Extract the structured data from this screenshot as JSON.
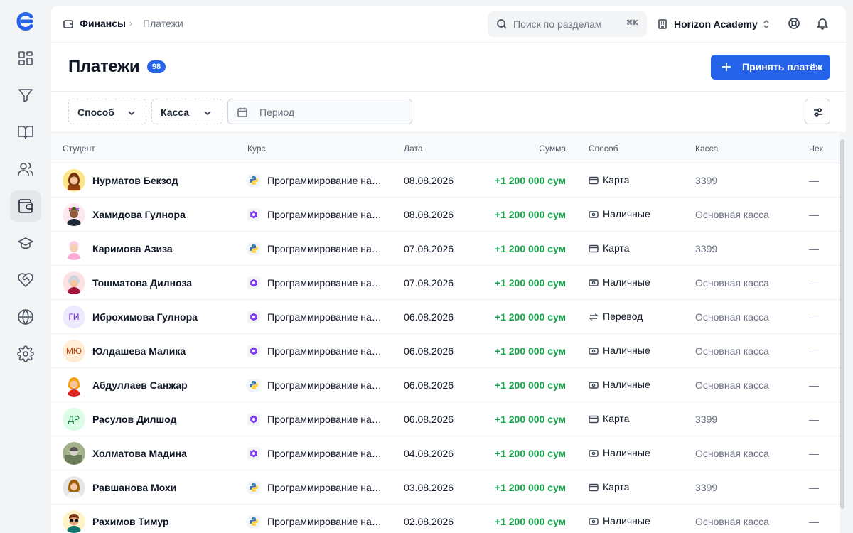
{
  "sidebar": {
    "logo": "E",
    "items": [
      {
        "icon": "dashboard-icon",
        "active": false
      },
      {
        "icon": "funnel-icon",
        "active": false
      },
      {
        "icon": "book-icon",
        "active": false
      },
      {
        "icon": "users-icon",
        "active": false
      },
      {
        "icon": "wallet-icon",
        "active": true
      },
      {
        "icon": "graduation-cap-icon",
        "active": false
      },
      {
        "icon": "heart-handshake-icon",
        "active": false
      },
      {
        "icon": "globe-icon",
        "active": false
      },
      {
        "icon": "gear-icon",
        "active": false
      }
    ]
  },
  "topbar": {
    "breadcrumb_root": "Финансы",
    "breadcrumb_sep": "›",
    "breadcrumb_current": "Платежи",
    "search_placeholder": "Поиск по разделам",
    "search_shortcut": "⌘K",
    "org_name": "Horizon Academy"
  },
  "header": {
    "title": "Платежи",
    "count": "98",
    "primary_button": "Принять платёж"
  },
  "filters": {
    "method_label": "Способ",
    "cashbox_label": "Касса",
    "period_placeholder": "Период"
  },
  "table": {
    "columns": {
      "student": "Студент",
      "course": "Курс",
      "date": "Дата",
      "amount": "Сумма",
      "method": "Способ",
      "cashbox": "Касса",
      "receipt": "Чек"
    },
    "rows": [
      {
        "avatar": "photo",
        "avatar_style": "woman-hijab",
        "name": "Нурматов Бекзод",
        "course_icon": "python",
        "course": "Программирование на Python",
        "date": "08.08.2026",
        "amount": "+1 200 000 сум",
        "method_icon": "card",
        "method": "Карта",
        "cashbox": "3399",
        "receipt": "—"
      },
      {
        "avatar": "photo",
        "avatar_style": "man-curly",
        "name": "Хамидова Гулнора",
        "course_icon": "hex",
        "course": "Программирование на C#",
        "date": "08.08.2026",
        "amount": "+1 200 000 сум",
        "method_icon": "cash",
        "method": "Наличные",
        "cashbox": "Основная касса",
        "receipt": "—"
      },
      {
        "avatar": "photo",
        "avatar_style": "woman-pink",
        "name": "Каримова Азиза",
        "course_icon": "python",
        "course": "Программирование на Python",
        "date": "07.08.2026",
        "amount": "+1 200 000 сум",
        "method_icon": "card",
        "method": "Карта",
        "cashbox": "3399",
        "receipt": "—"
      },
      {
        "avatar": "photo",
        "avatar_style": "woman-grey",
        "name": "Тошматова Дилноза",
        "course_icon": "hex",
        "course": "Программирование на C#",
        "date": "07.08.2026",
        "amount": "+1 200 000 сум",
        "method_icon": "cash",
        "method": "Наличные",
        "cashbox": "Основная касса",
        "receipt": "—"
      },
      {
        "avatar": "initials",
        "initials": "ГИ",
        "avatar_bg": "#ede9fe",
        "avatar_fg": "#6d28d9",
        "name": "Иброхимова Гулнора",
        "course_icon": "hex",
        "course": "Программирование на C#",
        "date": "06.08.2026",
        "amount": "+1 200 000 сум",
        "method_icon": "transfer",
        "method": "Перевод",
        "cashbox": "Основная касса",
        "receipt": "—"
      },
      {
        "avatar": "initials",
        "initials": "МЮ",
        "avatar_bg": "#ffedd5",
        "avatar_fg": "#c2410c",
        "name": "Юлдашева Малика",
        "course_icon": "hex",
        "course": "Программирование на C#",
        "date": "06.08.2026",
        "amount": "+1 200 000 сум",
        "method_icon": "cash",
        "method": "Наличные",
        "cashbox": "Основная касса",
        "receipt": "—"
      },
      {
        "avatar": "photo",
        "avatar_style": "woman-blonde",
        "name": "Абдуллаев Санжар",
        "course_icon": "python",
        "course": "Программирование на Python",
        "date": "06.08.2026",
        "amount": "+1 200 000 сум",
        "method_icon": "cash",
        "method": "Наличные",
        "cashbox": "Основная касса",
        "receipt": "—"
      },
      {
        "avatar": "initials",
        "initials": "ДР",
        "avatar_bg": "#dcfce7",
        "avatar_fg": "#15803d",
        "name": "Расулов Дилшод",
        "course_icon": "hex",
        "course": "Программирование на C#",
        "date": "06.08.2026",
        "amount": "+1 200 000 сум",
        "method_icon": "card",
        "method": "Карта",
        "cashbox": "3399",
        "receipt": "—"
      },
      {
        "avatar": "photo",
        "avatar_style": "photo-green",
        "name": "Холматова Мадина",
        "course_icon": "hex",
        "course": "Программирование на C#",
        "date": "04.08.2026",
        "amount": "+1 200 000 сум",
        "method_icon": "cash",
        "method": "Наличные",
        "cashbox": "Основная касса",
        "receipt": "—"
      },
      {
        "avatar": "photo",
        "avatar_style": "photo-woman",
        "name": "Равшанова Мохи",
        "course_icon": "python",
        "course": "Программирование на Python",
        "date": "03.08.2026",
        "amount": "+1 200 000 сум",
        "method_icon": "card",
        "method": "Карта",
        "cashbox": "3399",
        "receipt": "—"
      },
      {
        "avatar": "photo",
        "avatar_style": "man-glasses",
        "name": "Рахимов Тимур",
        "course_icon": "python",
        "course": "Программирование на Python",
        "date": "02.08.2026",
        "amount": "+1 200 000 сум",
        "method_icon": "cash",
        "method": "Наличные",
        "cashbox": "Основная касса",
        "receipt": "—"
      }
    ]
  },
  "colors": {
    "accent": "#2563eb",
    "amount_positive": "#16a34a",
    "logo": "#2563eb"
  }
}
